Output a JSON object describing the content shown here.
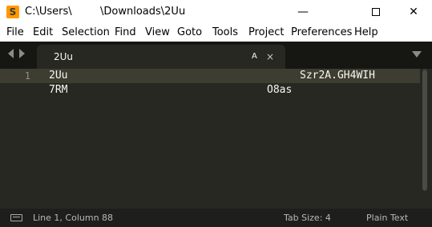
{
  "titlebar": {
    "app_icon_letter": "S",
    "path_part1": "C:\\Users\\",
    "path_part2": "\\Downloads\\2Uu",
    "minimize": "—",
    "close": "✕"
  },
  "menu": {
    "items": [
      "File",
      "Edit",
      "Selection",
      "Find",
      "View",
      "Goto",
      "Tools",
      "Project",
      "Preferences",
      "Help"
    ]
  },
  "tab": {
    "label": "2Uu",
    "dirty_marker": "A",
    "close": "×"
  },
  "editor": {
    "line_numbers": [
      "1"
    ],
    "lines": [
      {
        "left": "2Uu",
        "right": "Szr2A.GH4WIH"
      },
      {
        "left": "7RM",
        "right": "O8as"
      }
    ]
  },
  "status": {
    "position": "Line 1, Column 88",
    "tab_size": "Tab Size: 4",
    "syntax": "Plain Text"
  },
  "colors": {
    "editor_bg": "#272822",
    "text": "#f8f8f2",
    "accent_icon": "#ff9800"
  },
  "icons": [
    "sublime-text-app-icon",
    "minimize-icon",
    "maximize-icon",
    "close-icon",
    "tab-left-arrow-icon",
    "tab-right-arrow-icon",
    "tab-close-icon",
    "tab-overflow-chevron-icon",
    "status-panel-icon"
  ]
}
